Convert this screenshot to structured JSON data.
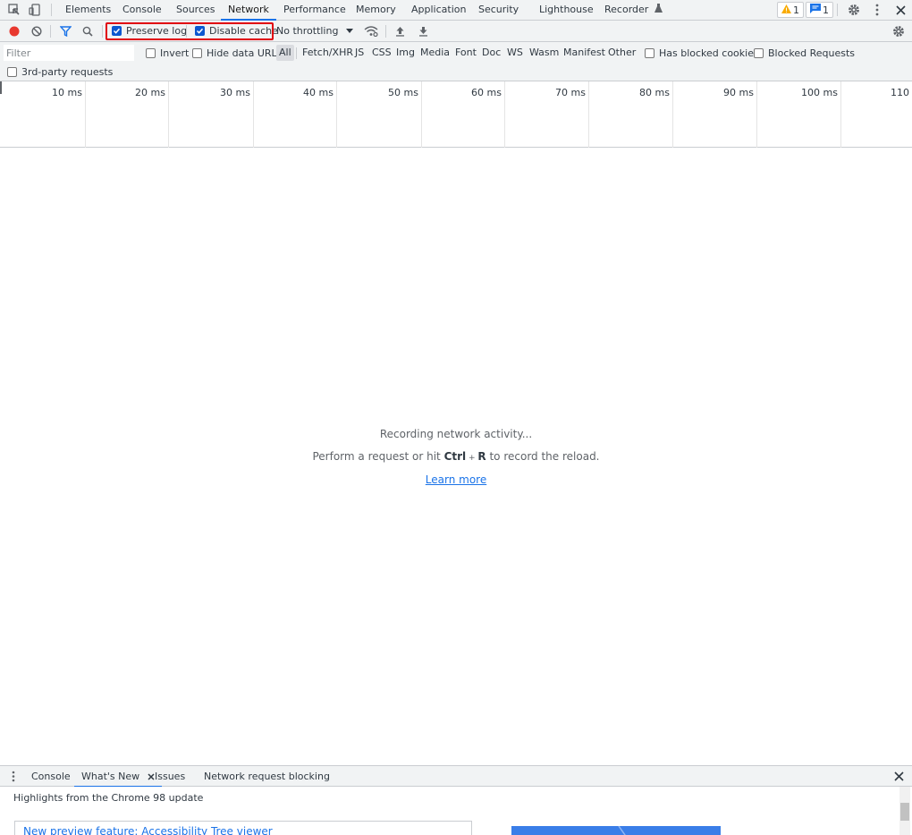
{
  "main_tabs": [
    "Elements",
    "Console",
    "Sources",
    "Network",
    "Performance",
    "Memory",
    "Application",
    "Security",
    "Lighthouse",
    "Recorder"
  ],
  "active_tab": "Network",
  "badges": {
    "warnings": "1",
    "messages": "1"
  },
  "toolbar": {
    "preserve_log_label": "Preserve log",
    "preserve_log_checked": true,
    "disable_cache_label": "Disable cache",
    "disable_cache_checked": true,
    "throttling_value": "No throttling"
  },
  "filter": {
    "placeholder": "Filter",
    "invert_label": "Invert",
    "hide_data_urls_label": "Hide data URLs",
    "types": [
      "All",
      "Fetch/XHR",
      "JS",
      "CSS",
      "Img",
      "Media",
      "Font",
      "Doc",
      "WS",
      "Wasm",
      "Manifest",
      "Other"
    ],
    "active_type": "All",
    "has_blocked_cookies_label": "Has blocked cookies",
    "blocked_requests_label": "Blocked Requests",
    "third_party_label": "3rd-party requests"
  },
  "timeline_ticks": [
    "10 ms",
    "20 ms",
    "30 ms",
    "40 ms",
    "50 ms",
    "60 ms",
    "70 ms",
    "80 ms",
    "90 ms",
    "100 ms",
    "110"
  ],
  "empty_state": {
    "title": "Recording network activity...",
    "hint_prefix": "Perform a request or hit ",
    "hint_key_1": "Ctrl",
    "hint_plus": " + ",
    "hint_key_2": "R",
    "hint_suffix": " to record the reload.",
    "learn_more": "Learn more"
  },
  "drawer": {
    "tabs": [
      "Console",
      "What's New",
      "Issues",
      "Network request blocking"
    ],
    "active_tab": "What's New",
    "heading": "Highlights from the Chrome 98 update",
    "feature_link": "New preview feature: Accessibility Tree viewer"
  },
  "colors": {
    "accent": "#1a73e8",
    "record": "#e8382f",
    "highlight": "#e0000e"
  }
}
